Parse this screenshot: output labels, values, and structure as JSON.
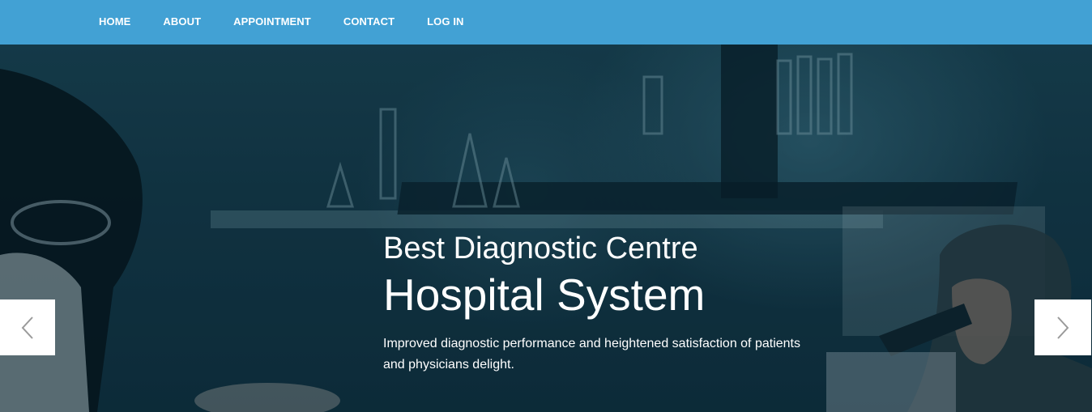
{
  "nav": {
    "items": [
      {
        "label": "HOME"
      },
      {
        "label": "ABOUT"
      },
      {
        "label": "APPOINTMENT"
      },
      {
        "label": "CONTACT"
      },
      {
        "label": "LOG IN"
      }
    ]
  },
  "hero": {
    "subtitle": "Best Diagnostic Centre",
    "title": "Hospital System",
    "description": "Improved diagnostic performance and heightened satisfaction of patients and physicians delight.",
    "prev_icon": "chevron-left-icon",
    "next_icon": "chevron-right-icon"
  },
  "colors": {
    "navbar": "#42a1d4",
    "text": "#ffffff"
  }
}
